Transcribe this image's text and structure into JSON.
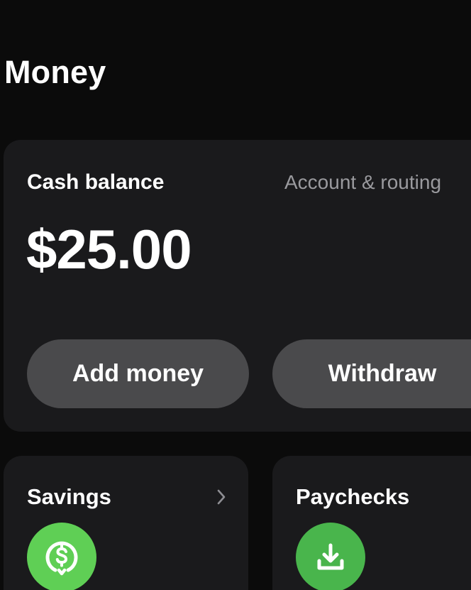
{
  "page": {
    "title": "Money"
  },
  "cash_card": {
    "label": "Cash balance",
    "account_link": "Account & routing",
    "balance": "$25.00",
    "add_button": "Add money",
    "withdraw_button": "Withdraw"
  },
  "tiles": {
    "savings": {
      "title": "Savings",
      "icon": "savings-dollar-icon"
    },
    "paychecks": {
      "title": "Paychecks",
      "icon": "download-tray-icon"
    }
  },
  "colors": {
    "background": "#0b0b0b",
    "card": "#1a1a1c",
    "button": "#4a4a4c",
    "muted_text": "#9a9a9e",
    "savings_green": "#5fcf55",
    "paychecks_green": "#49b54c"
  }
}
